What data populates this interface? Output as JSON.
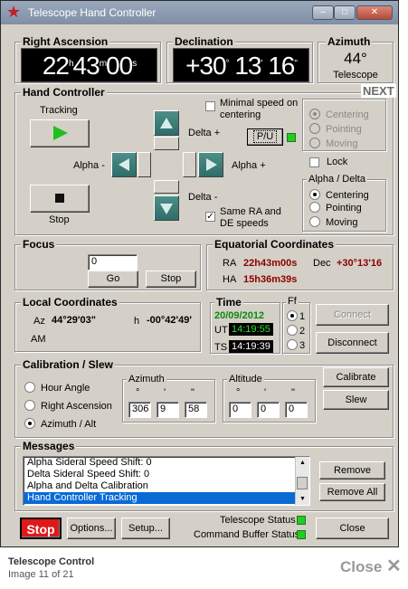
{
  "window": {
    "title": "Telescope Hand Controller"
  },
  "ra": {
    "title": "Right Ascension",
    "h": "22",
    "m": "43",
    "s": "00",
    "h_unit": "h",
    "m_unit": "m",
    "s_unit": "s"
  },
  "dec": {
    "title": "Declination",
    "d": "+30",
    "m": "13",
    "s": "16"
  },
  "azimuth_box": {
    "title": "Azimuth",
    "value": "44°",
    "sub": "Telescope"
  },
  "next_label": "NEXT",
  "hand": {
    "title": "Hand Controller",
    "tracking": "Tracking",
    "stop": "Stop",
    "alpha_minus": "Alpha -",
    "alpha_plus": "Alpha +",
    "delta_plus": "Delta +",
    "delta_minus": "Delta -",
    "minimal_speed": "Minimal speed on centering",
    "pu_button": "P/U",
    "same_speeds": "Same RA and DE speeds",
    "lock": "Lock",
    "mode_options": [
      "Centering",
      "Pointing",
      "Moving"
    ],
    "alpha_delta_title": "Alpha / Delta",
    "ad_options": [
      "Centering",
      "Pointing",
      "Moving"
    ]
  },
  "focus": {
    "title": "Focus",
    "value": "0",
    "go": "Go",
    "stop": "Stop"
  },
  "equatorial": {
    "title": "Equatorial Coordinates",
    "ra_label": "RA",
    "ra_value": "22h43m00s",
    "dec_label": "Dec",
    "dec_value": "+30°13'16",
    "ha_label": "HA",
    "ha_value": "15h36m39s"
  },
  "local": {
    "title": "Local Coordinates",
    "az_label": "Az",
    "az_value": "44°29'03\"",
    "h_label": "h",
    "h_value": "-00°42'49'",
    "ampm": "AM"
  },
  "time": {
    "title": "Time",
    "date": "20/09/2012",
    "ut_label": "UT",
    "ut_value": "14:19:55",
    "ts_label": "TS",
    "ts_value": "14:19:39"
  },
  "ff": {
    "title": "Ff",
    "options": [
      "1",
      "2",
      "3"
    ],
    "selected": 0
  },
  "connect": "Connect",
  "disconnect": "Disconnect",
  "calibration": {
    "title": "Calibration / Slew",
    "options": [
      "Hour Angle",
      "Right Ascension",
      "Azimuth / Alt"
    ],
    "azimuth_title": "Azimuth",
    "altitude_title": "Altitude",
    "az_values": [
      "306",
      "9",
      "58"
    ],
    "alt_values": [
      "0",
      "0",
      "0"
    ],
    "calibrate": "Calibrate",
    "slew": "Slew"
  },
  "messages": {
    "title": "Messages",
    "items": [
      "Alpha Sideral Speed Shift: 0",
      "Delta Sideral Speed Shift: 0",
      "Alpha and Delta Calibration",
      "Hand Controller Tracking"
    ],
    "remove": "Remove",
    "remove_all": "Remove All"
  },
  "bottom": {
    "stop": "Stop",
    "options": "Options...",
    "setup": "Setup...",
    "telescope_status": "Telescope Status",
    "command_buffer": "Command Buffer Status",
    "close": "Close"
  },
  "caption": {
    "title": "Telescope Control",
    "counter": "Image 11 of 21",
    "close": "Close"
  }
}
